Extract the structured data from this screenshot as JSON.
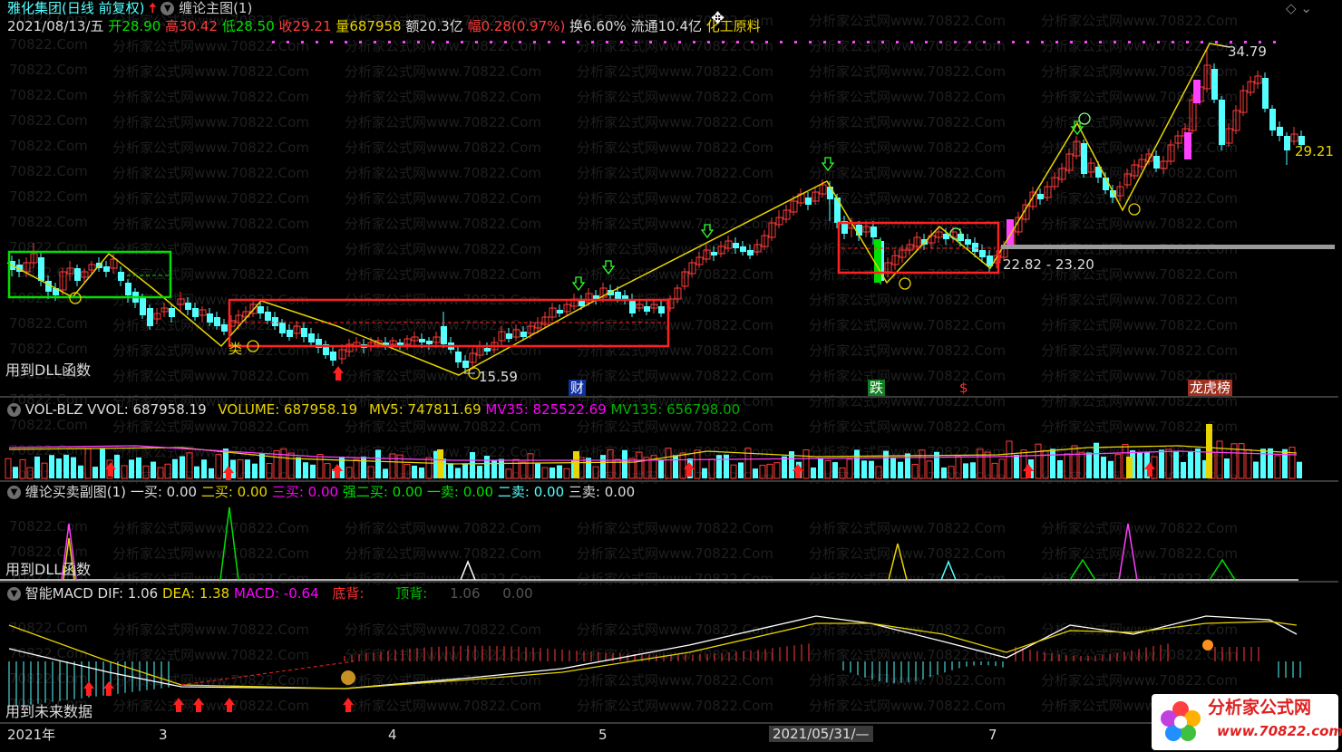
{
  "header": {
    "stock": "雅化集团",
    "period": "(日线 前复权)",
    "indicator": "缠论主图(1)",
    "date": "2021/08/13/五",
    "open_label": "开",
    "open": "28.90",
    "high_label": "高",
    "high": "30.42",
    "low_label": "低",
    "low": "28.50",
    "close_label": "收",
    "close": "29.21",
    "vol_label": "量",
    "vol": "687958",
    "amount_label": "额",
    "amount": "20.3亿",
    "change_label": "幅",
    "change": "0.28(0.97%)",
    "turnover_label": "换",
    "turnover": "6.60%",
    "float_label": "流通",
    "float": "10.4亿",
    "sector": "化工原料"
  },
  "main": {
    "label_dll": "用到DLL函数",
    "price_high": "34.79",
    "price_last": "29.21",
    "price_low": "15.59",
    "range": "22.82 - 23.20",
    "tag_lei": "类",
    "events": [
      "财",
      "跌",
      "$",
      "龙虎榜"
    ]
  },
  "vol_panel": {
    "name": "VOL-BLZ",
    "vvol": "VVOL: 687958.19",
    "volume": "VOLUME: 687958.19",
    "mv5": "MV5: 747811.69",
    "mv35": "MV35: 825522.69",
    "mv135": "MV135: 656798.00"
  },
  "bs_panel": {
    "name": "缠论买卖副图(1)",
    "buy1": "一买: 0.00",
    "buy2": "二买: 0.00",
    "buy3": "三买: 0.00",
    "buy2s": "强二买: 0.00",
    "sell1": "一卖: 0.00",
    "sell2": "二卖: 0.00",
    "sell3": "三卖: 0.00",
    "label_dll": "用到DLL函数"
  },
  "macd_panel": {
    "name": "智能MACD",
    "dif": "DIF: 1.06",
    "dea": "DEA: 1.38",
    "macd": "MACD: -0.64",
    "bottom": "底背:",
    "top": "顶背:",
    "v1": "1.06",
    "v2": "0.00",
    "label_future": "用到未来数据"
  },
  "xaxis": {
    "year": "2021年",
    "m3": "3",
    "m4": "4",
    "m5": "5",
    "cursor_date": "2021/05/31/—",
    "m7": "7"
  },
  "watermark": {
    "a": "70822.Com",
    "b": "分析家公式网www.70822.Com"
  },
  "logo": {
    "title": "分析家公式网",
    "url": "www.70822.com"
  },
  "colors": {
    "up": "#ff3c3c",
    "down": "#54ffff",
    "yellow": "#e8d400",
    "green": "#00e000",
    "magenta": "#ff00ff",
    "white": "#ffffff"
  }
}
